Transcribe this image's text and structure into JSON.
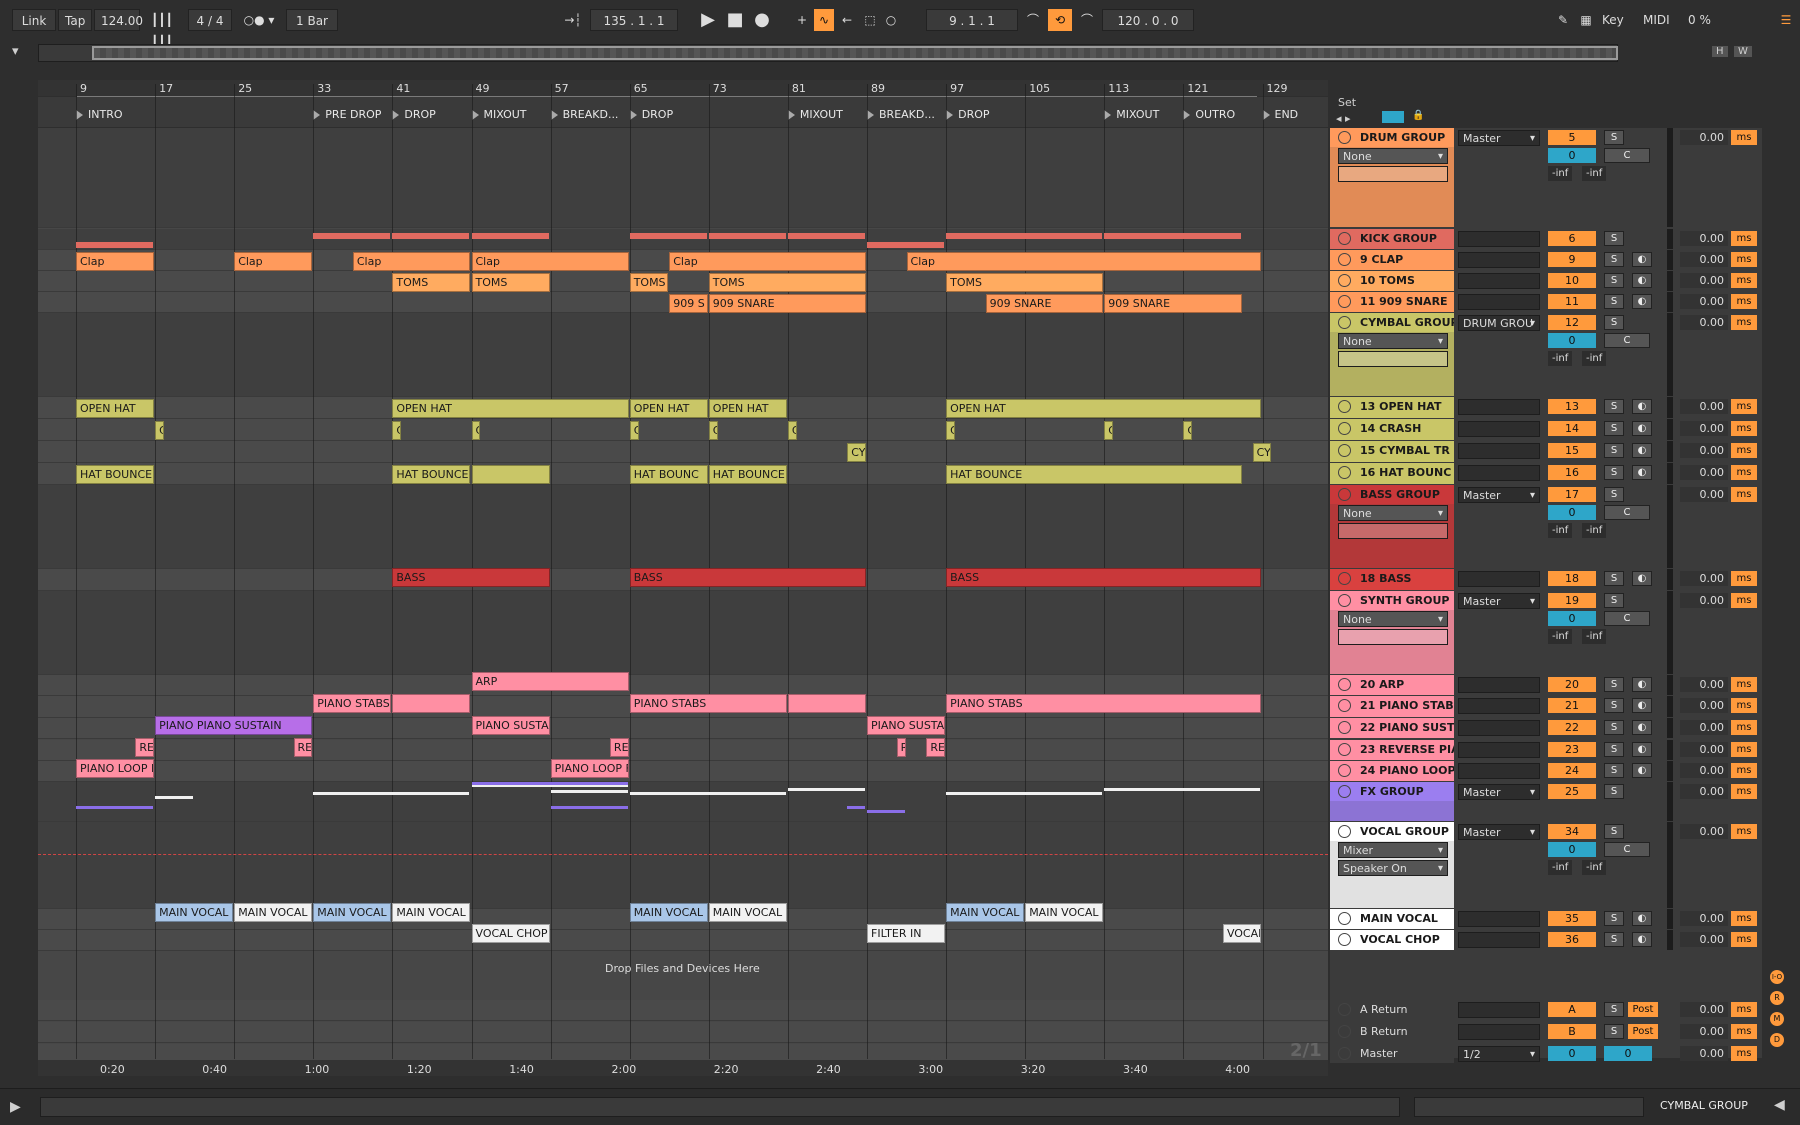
{
  "control": {
    "link": "Link",
    "tap": "Tap",
    "tempo": "124.00",
    "signature": "4 / 4",
    "quantize": "1 Bar",
    "position": "135 .  1 .  1",
    "loop_start": "9 .  1 .  1",
    "loop_length": "120 .  0 .  0",
    "key": "Key",
    "midi": "MIDI",
    "cpu": "0 %"
  },
  "overview": {
    "h": "H",
    "w": "W"
  },
  "bars": [
    "9",
    "17",
    "25",
    "33",
    "41",
    "49",
    "57",
    "65",
    "73",
    "81",
    "89",
    "97",
    "105",
    "113",
    "121",
    "129"
  ],
  "locators": [
    "INTRO",
    "PRE DROP",
    "DROP",
    "MIXOUT",
    "BREAKD...",
    "DROP",
    "MIXOUT",
    "BREAKD...",
    "DROP",
    "MIXOUT",
    "OUTRO",
    "END"
  ],
  "times": [
    "0:20",
    "0:40",
    "1:00",
    "1:20",
    "1:40",
    "2:00",
    "2:20",
    "2:40",
    "3:00",
    "3:20",
    "3:40",
    "4:00"
  ],
  "clips": {
    "clap": "Clap",
    "toms": "TOMS",
    "snare": "909 SNARE",
    "snare_short": "909 S",
    "open_hat": "OPEN HAT",
    "hat_bounce": "HAT BOUNCE",
    "hat_bounce_short": "HAT BOUNC",
    "c": "C",
    "cy": "CY",
    "bass": "BASS",
    "arp": "ARP",
    "piano_stabs": "PIANO STABS",
    "piano_piano_sustain": "PIANO PIANO SUSTAIN",
    "piano_susta": "PIANO SUSTA",
    "rev": "REV",
    "re": "RE",
    "r": "R",
    "piano_loop": "PIANO LOOP F",
    "main_vocal": "MAIN VOCAL",
    "vocal_chop": "VOCAL CHOP",
    "filter_in": "FILTER IN",
    "vocal": "VOCAL"
  },
  "drop_text": "Drop Files and Devices Here",
  "set_label": "Set",
  "mixer": [
    {
      "name": "DRUM GROUP",
      "out": "Master",
      "num": "5",
      "color": "#ff9a5c"
    },
    {
      "name": "KICK GROUP",
      "num": "6",
      "color": "#e06a60"
    },
    {
      "name": "9 CLAP",
      "num": "9",
      "color": "#ff9a5c"
    },
    {
      "name": "10 TOMS",
      "num": "10",
      "color": "#ffab60"
    },
    {
      "name": "11 909 SNARE",
      "num": "11",
      "color": "#ff9a5c"
    },
    {
      "name": "CYMBAL GROUP",
      "out": "DRUM GROU",
      "num": "12",
      "color": "#c9c667"
    },
    {
      "name": "13 OPEN HAT",
      "num": "13",
      "color": "#c9c667"
    },
    {
      "name": "14 CRASH",
      "num": "14",
      "color": "#c9c667"
    },
    {
      "name": "15 CYMBAL TR",
      "num": "15",
      "color": "#c9c667"
    },
    {
      "name": "16 HAT BOUNC",
      "num": "16",
      "color": "#c9c667"
    },
    {
      "name": "BASS GROUP",
      "out": "Master",
      "num": "17",
      "color": "#c9383a"
    },
    {
      "name": "18 BASS",
      "num": "18",
      "color": "#d9413f"
    },
    {
      "name": "SYNTH GROUP",
      "out": "Master",
      "num": "19",
      "color": "#ff8fa3"
    },
    {
      "name": "20 ARP",
      "num": "20",
      "color": "#ff8fa3"
    },
    {
      "name": "21 PIANO STABS",
      "num": "21",
      "color": "#ff8fa3"
    },
    {
      "name": "22 PIANO SUST",
      "num": "22",
      "color": "#ff8fa3"
    },
    {
      "name": "23 REVERSE PIA",
      "num": "23",
      "color": "#ff8fa3"
    },
    {
      "name": "24 PIANO LOOP",
      "num": "24",
      "color": "#ff8fa3"
    },
    {
      "name": "FX GROUP",
      "out": "Master",
      "num": "25",
      "color": "#9b7ef0"
    },
    {
      "name": "VOCAL GROUP",
      "out": "Master",
      "num": "34",
      "color": "#ffffff"
    },
    {
      "name": "MAIN VOCAL",
      "num": "35",
      "color": "#ffffff"
    },
    {
      "name": "VOCAL CHOP",
      "num": "36",
      "color": "#ffffff"
    }
  ],
  "mixer_common": {
    "solo": "S",
    "zero": "0",
    "center": "C",
    "inf": "-inf",
    "delay": "0.00",
    "ms": "ms",
    "none": "None",
    "mixer": "Mixer",
    "speaker": "Speaker On"
  },
  "returns": [
    {
      "name": "A Return",
      "num": "A",
      "post": "Post"
    },
    {
      "name": "B Return",
      "num": "B",
      "post": "Post"
    },
    {
      "name": "Master",
      "num": "0",
      "io": "1/2"
    }
  ],
  "page_indicator": "2/1",
  "side_letters": [
    "I-O",
    "R",
    "M",
    "D"
  ],
  "status": {
    "selected": "CYMBAL GROUP"
  }
}
